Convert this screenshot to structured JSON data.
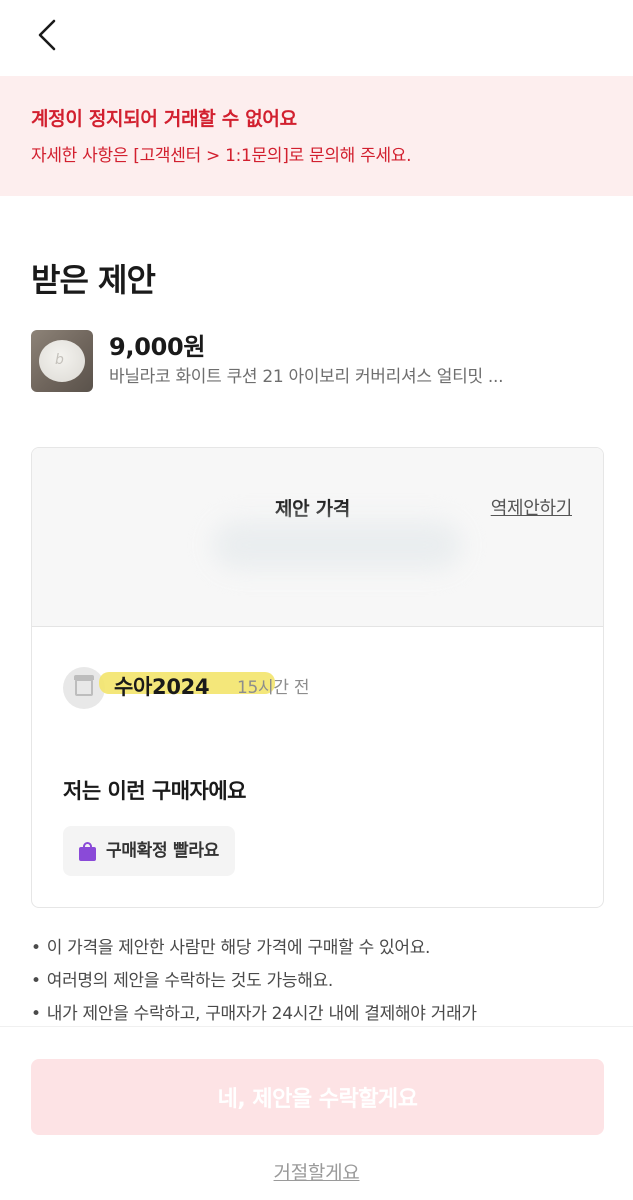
{
  "header": {
    "back_icon": "chevron-left-icon"
  },
  "alert": {
    "title": "계정이 정지되어 거래할 수 없어요",
    "body": "자세한 사항은 [고객센터 > 1:1문의]로 문의해 주세요.",
    "color": "#d2202f",
    "background": "#fdeeee"
  },
  "page": {
    "title": "받은 제안"
  },
  "product": {
    "price": "9,000원",
    "name": "바닐라코 화이트 쿠션 21 아이보리 커버리셔스 얼티밋 ..."
  },
  "offer": {
    "label": "제안 가격",
    "counter_offer": "역제안하기"
  },
  "buyer": {
    "name": "수아2024",
    "time": "15시간 전",
    "avatar_icon": "store-icon",
    "heading": "저는 이런 구매자에요",
    "badge": "구매확정 빨라요",
    "badge_icon": "shopping-bag-icon",
    "badge_color": "#8a4ad8"
  },
  "notes": [
    "이 가격을 제안한 사람만 해당 가격에 구매할 수 있어요.",
    "여러명의 제안을 수락하는 것도 가능해요.",
    "내가 제안을 수락하고, 구매자가 24시간 내에 결제해야 거래가"
  ],
  "actions": {
    "accept": "네, 제안을 수락할게요",
    "accept_color": "#fde3e5",
    "reject": "거절할게요"
  }
}
